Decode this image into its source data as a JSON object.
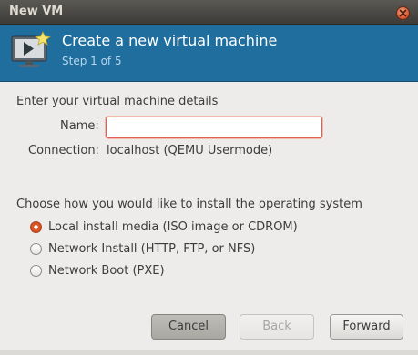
{
  "window": {
    "title": "New VM"
  },
  "banner": {
    "heading": "Create a new virtual machine",
    "step": "Step 1 of 5"
  },
  "details": {
    "section_label": "Enter your virtual machine details",
    "name_label": "Name:",
    "name_value": "",
    "connection_label": "Connection:",
    "connection_value": "localhost (QEMU Usermode)"
  },
  "install": {
    "section_label": "Choose how you would like to install the operating system",
    "options": [
      {
        "label": "Local install media (ISO image or CDROM)",
        "selected": true
      },
      {
        "label": "Network Install (HTTP, FTP, or NFS)",
        "selected": false
      },
      {
        "label": "Network Boot (PXE)",
        "selected": false
      }
    ]
  },
  "buttons": {
    "cancel": "Cancel",
    "back": "Back",
    "forward": "Forward"
  },
  "colors": {
    "banner": "#1f6e9e",
    "titlebar": "#3c3b37",
    "accent": "#e25a2a"
  }
}
